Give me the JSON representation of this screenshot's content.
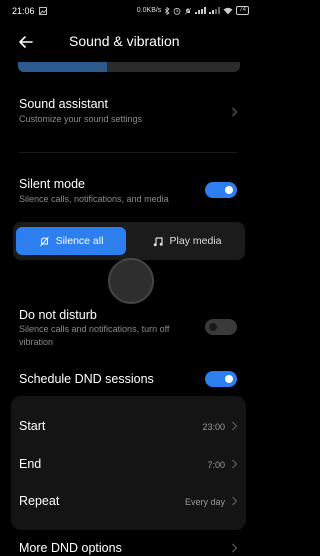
{
  "status_bar": {
    "time": "21:06",
    "speed": "0.0KB/s",
    "battery": "74"
  },
  "header": {
    "title": "Sound & vibration"
  },
  "volume_slider": {
    "level": 0.4
  },
  "sound_assistant": {
    "title": "Sound assistant",
    "subtitle": "Customize your sound settings"
  },
  "silent_mode": {
    "title": "Silent mode",
    "subtitle": "Silence calls, notifications, and media",
    "enabled": true,
    "options": [
      {
        "label": "Silence all",
        "icon": "bell-off-icon",
        "selected": true
      },
      {
        "label": "Play media",
        "icon": "music-note-icon",
        "selected": false
      }
    ]
  },
  "do_not_disturb": {
    "title": "Do not disturb",
    "subtitle": "Silence calls and notifications, turn off vibration",
    "enabled": false
  },
  "schedule_dnd": {
    "title": "Schedule DND sessions",
    "enabled": true
  },
  "schedule": {
    "start_label": "Start",
    "start_value": "23:00",
    "end_label": "End",
    "end_value": "7:00",
    "repeat_label": "Repeat",
    "repeat_value": "Every day"
  },
  "more_dnd": {
    "label": "More DND options"
  },
  "colors": {
    "accent": "#2d7ff0",
    "background": "#000000",
    "secondary_text": "#8b8b8b"
  }
}
